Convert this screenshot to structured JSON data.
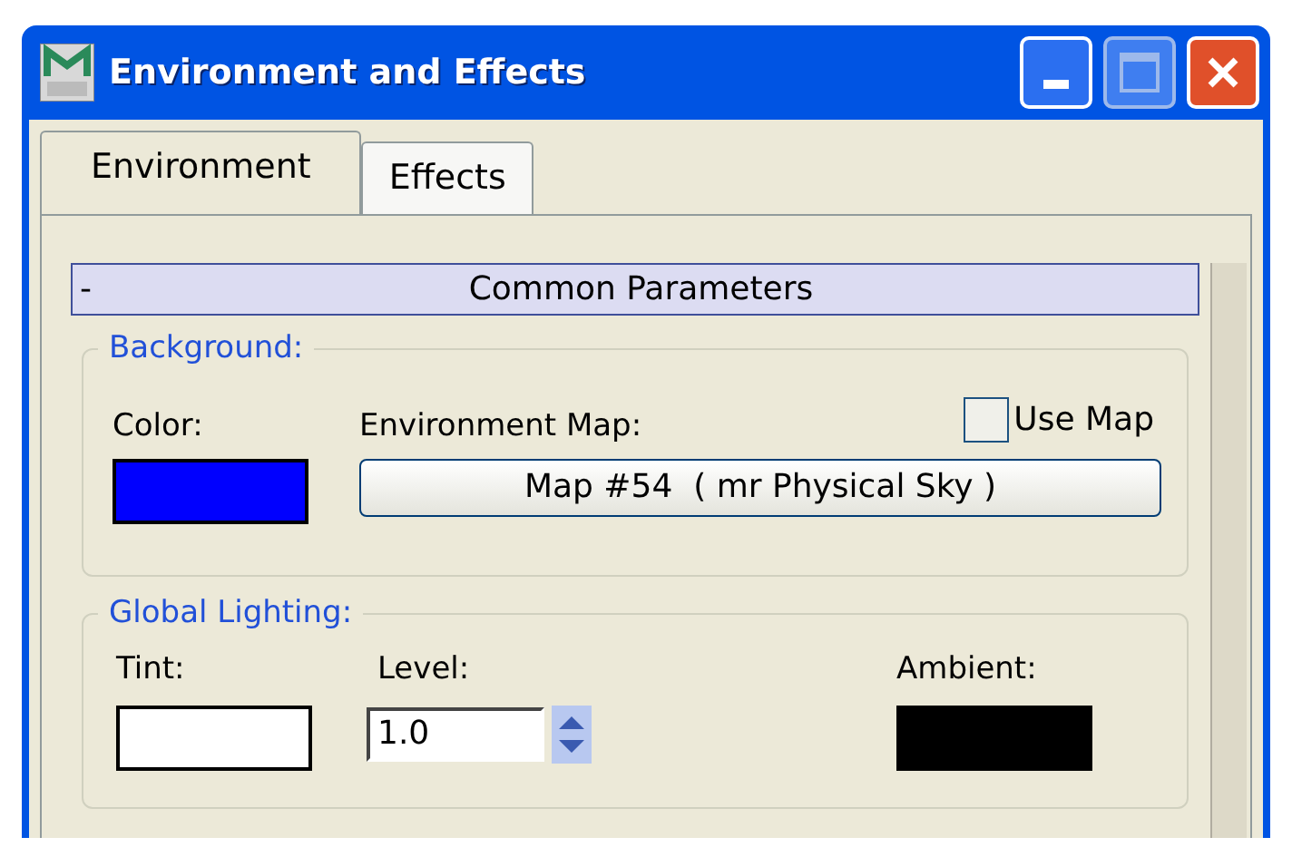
{
  "window": {
    "title": "Environment and Effects"
  },
  "tabs": [
    {
      "label": "Environment",
      "selected": true
    },
    {
      "label": "Effects",
      "selected": false
    }
  ],
  "rollout": {
    "toggle": "-",
    "title": "Common Parameters",
    "expanded": true
  },
  "background": {
    "title": "Background:",
    "color_label": "Color:",
    "color": "#0000ff",
    "map_label": "Environment Map:",
    "use_map": {
      "label": "Use Map",
      "checked": false
    },
    "map_button": "Map #54  ( mr Physical Sky )"
  },
  "global_lighting": {
    "title": "Global Lighting:",
    "tint": {
      "label": "Tint:",
      "color": "#ffffff"
    },
    "level_label": "Level:",
    "level_value": "1.0",
    "ambient": {
      "label": "Ambient:",
      "color": "#000000"
    }
  }
}
